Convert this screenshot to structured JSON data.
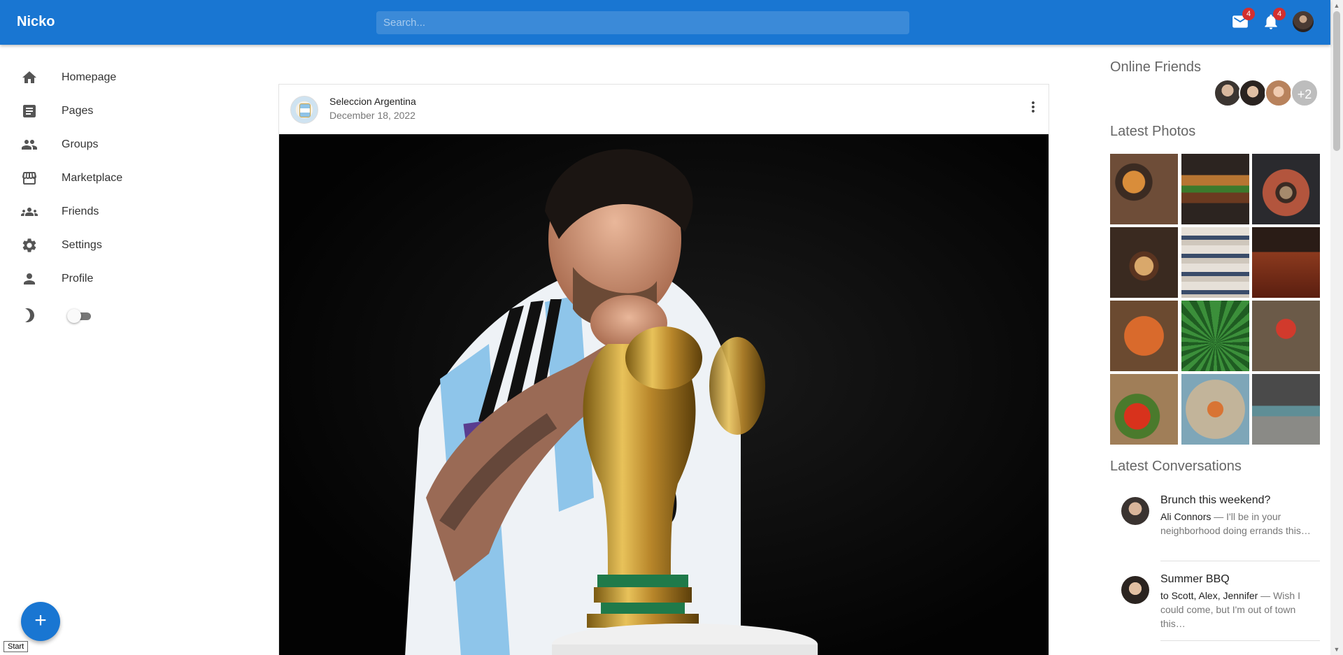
{
  "app": {
    "brand": "Nicko"
  },
  "topbar": {
    "search_placeholder": "Search...",
    "mail_count": "4",
    "notification_count": "4"
  },
  "nav": {
    "items": [
      {
        "label": "Homepage",
        "icon": "home-icon"
      },
      {
        "label": "Pages",
        "icon": "article-icon"
      },
      {
        "label": "Groups",
        "icon": "people-icon"
      },
      {
        "label": "Marketplace",
        "icon": "storefront-icon"
      },
      {
        "label": "Friends",
        "icon": "groups-icon"
      },
      {
        "label": "Settings",
        "icon": "settings-icon"
      },
      {
        "label": "Profile",
        "icon": "person-icon"
      }
    ],
    "dark_mode_enabled": false
  },
  "fab": {
    "label": "+",
    "tooltip": "Start"
  },
  "post": {
    "author": "Seleccion Argentina",
    "date": "December 18, 2022"
  },
  "right": {
    "online_title": "Online Friends",
    "online_more": "+2",
    "photos_title": "Latest Photos",
    "conversations_title": "Latest Conversations",
    "conversations": [
      {
        "title": "Brunch this weekend?",
        "from": "Ali Connors",
        "text": " — I'll be in your neighborhood doing errands this…"
      },
      {
        "title": "Summer BBQ",
        "from": "to Scott, Alex, Jennifer",
        "text": " — Wish I could come, but I'm out of town this…"
      }
    ]
  },
  "colors": {
    "primary": "#1976d2",
    "badge": "#d32f2f"
  }
}
